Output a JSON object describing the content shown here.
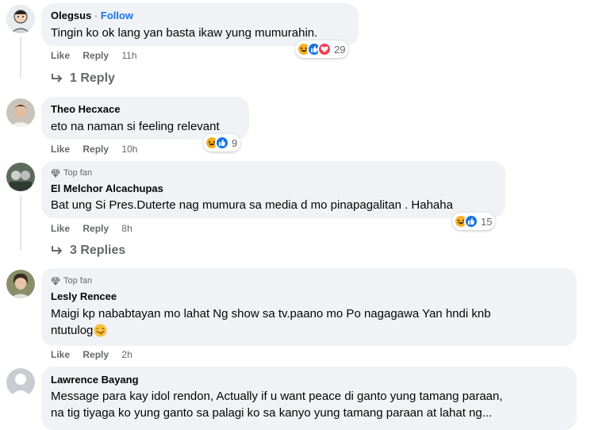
{
  "colors": {
    "bubble": "#f0f2f5",
    "link": "#1b74e4",
    "muted": "#65676b",
    "haha": "#f7b125",
    "like": "#1b74e4",
    "love": "#f33e58"
  },
  "comments": [
    {
      "name": "Olegsus",
      "separator": "·",
      "follow": "Follow",
      "text": "Tingin ko ok lang yan basta ikaw yung mumurahin.",
      "like": "Like",
      "reply": "Reply",
      "time": "11h",
      "reactions": [
        "haha-icon",
        "like-icon",
        "love-icon"
      ],
      "reaction_count": "29",
      "replies_label": "1 Reply"
    },
    {
      "name": "Theo Hecxace",
      "text": "eto na naman si feeling relevant",
      "like": "Like",
      "reply": "Reply",
      "time": "10h",
      "reactions": [
        "haha-icon",
        "like-icon"
      ],
      "reaction_count": "9"
    },
    {
      "badge": "Top fan",
      "name": "El Melchor Alcachupas",
      "text": "Bat ung Si Pres.Duterte nag mumura sa media d mo pinapagalitan . Hahaha",
      "like": "Like",
      "reply": "Reply",
      "time": "8h",
      "reactions": [
        "haha-icon",
        "like-icon"
      ],
      "reaction_count": "15",
      "replies_label": "3 Replies"
    },
    {
      "badge": "Top fan",
      "name": "Lesly Rencee",
      "text_line1": "Maigi kp nababtayan mo lahat Ng show sa tv.paano mo Po nagagawa Yan hndi knb",
      "text_line2": "ntutulog",
      "emoji": "tongue-emoji",
      "like": "Like",
      "reply": "Reply",
      "time": "2h"
    },
    {
      "name": "Lawrence Bayang",
      "text_line1": "Message para kay idol rendon, Actually if u want peace di ganto yung tamang paraan,",
      "text_line2": "na tig tiyaga ko yung ganto sa palagi ko sa kanyo yung tamang paraan at lahat ng..."
    }
  ]
}
